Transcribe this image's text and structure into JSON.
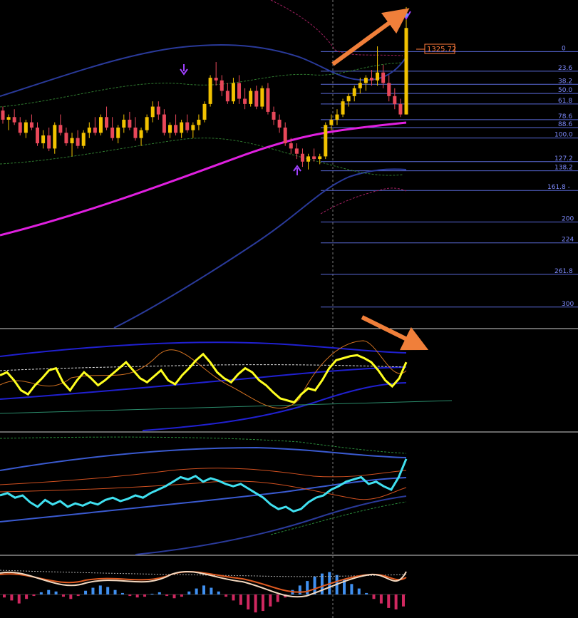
{
  "chart_data": {
    "type": "candlestick-with-indicators",
    "price_tag": "1325.72",
    "colors": {
      "background": "#000000",
      "bull": "#f2c200",
      "bear": "#e8485a",
      "ma": "#e020e0",
      "band_outer": "#2a3a9a",
      "band_inner": "#3a8a3a",
      "fib_line": "#5a6ad8",
      "arrow": "#f07f3a",
      "signal_up": "#a040ff",
      "rsi": "#ffff20",
      "rsi_band": "#2020d0",
      "cyan_line": "#40e0f0",
      "hist_pos": "#4090f0",
      "hist_neg": "#d02860"
    },
    "fib_levels": [
      {
        "label": "0",
        "price": 1310
      },
      {
        "label": "23.6",
        "price": 1295
      },
      {
        "label": "38.2",
        "price": 1285
      },
      {
        "label": "50.0",
        "price": 1278
      },
      {
        "label": "61.8",
        "price": 1270
      },
      {
        "label": "78.6",
        "price": 1258
      },
      {
        "label": "88.6",
        "price": 1252
      },
      {
        "label": "100.0",
        "price": 1244
      },
      {
        "label": "127.2",
        "price": 1226
      },
      {
        "label": "138.2",
        "price": 1219
      },
      {
        "label": "161.8 -",
        "price": 1204
      },
      {
        "label": "200",
        "price": 1180
      },
      {
        "label": "224",
        "price": 1164
      },
      {
        "label": "261.8",
        "price": 1140
      },
      {
        "label": "300",
        "price": 1115
      }
    ],
    "candles": [
      [
        1265,
        1268,
        1255,
        1258
      ],
      [
        1258,
        1262,
        1250,
        1260
      ],
      [
        1260,
        1266,
        1254,
        1256
      ],
      [
        1256,
        1260,
        1246,
        1248
      ],
      [
        1248,
        1258,
        1244,
        1256
      ],
      [
        1256,
        1262,
        1250,
        1252
      ],
      [
        1252,
        1256,
        1238,
        1240
      ],
      [
        1240,
        1250,
        1236,
        1246
      ],
      [
        1246,
        1252,
        1234,
        1236
      ],
      [
        1236,
        1256,
        1232,
        1254
      ],
      [
        1254,
        1262,
        1246,
        1248
      ],
      [
        1248,
        1252,
        1238,
        1240
      ],
      [
        1240,
        1248,
        1230,
        1244
      ],
      [
        1244,
        1250,
        1236,
        1238
      ],
      [
        1238,
        1250,
        1236,
        1248
      ],
      [
        1248,
        1256,
        1244,
        1252
      ],
      [
        1252,
        1260,
        1246,
        1248
      ],
      [
        1248,
        1262,
        1246,
        1260
      ],
      [
        1260,
        1268,
        1250,
        1252
      ],
      [
        1252,
        1260,
        1242,
        1244
      ],
      [
        1244,
        1254,
        1240,
        1252
      ],
      [
        1252,
        1262,
        1248,
        1258
      ],
      [
        1258,
        1264,
        1250,
        1252
      ],
      [
        1252,
        1260,
        1242,
        1244
      ],
      [
        1244,
        1252,
        1238,
        1250
      ],
      [
        1250,
        1262,
        1248,
        1260
      ],
      [
        1260,
        1272,
        1256,
        1268
      ],
      [
        1268,
        1272,
        1258,
        1262
      ],
      [
        1262,
        1266,
        1246,
        1248
      ],
      [
        1248,
        1256,
        1244,
        1254
      ],
      [
        1254,
        1262,
        1246,
        1248
      ],
      [
        1248,
        1258,
        1244,
        1256
      ],
      [
        1256,
        1262,
        1248,
        1250
      ],
      [
        1250,
        1256,
        1244,
        1254
      ],
      [
        1254,
        1262,
        1250,
        1258
      ],
      [
        1258,
        1272,
        1256,
        1270
      ],
      [
        1270,
        1292,
        1268,
        1290
      ],
      [
        1290,
        1302,
        1284,
        1288
      ],
      [
        1288,
        1292,
        1276,
        1280
      ],
      [
        1280,
        1286,
        1270,
        1272
      ],
      [
        1272,
        1290,
        1270,
        1286
      ],
      [
        1286,
        1292,
        1270,
        1274
      ],
      [
        1274,
        1282,
        1266,
        1270
      ],
      [
        1270,
        1282,
        1268,
        1280
      ],
      [
        1280,
        1284,
        1266,
        1268
      ],
      [
        1268,
        1284,
        1266,
        1282
      ],
      [
        1282,
        1286,
        1262,
        1264
      ],
      [
        1264,
        1268,
        1254,
        1258
      ],
      [
        1258,
        1262,
        1248,
        1252
      ],
      [
        1252,
        1256,
        1238,
        1240
      ],
      [
        1240,
        1244,
        1232,
        1236
      ],
      [
        1236,
        1240,
        1228,
        1232
      ],
      [
        1232,
        1236,
        1222,
        1226
      ],
      [
        1226,
        1232,
        1220,
        1230
      ],
      [
        1230,
        1236,
        1226,
        1228
      ],
      [
        1228,
        1232,
        1224,
        1230
      ],
      [
        1230,
        1256,
        1228,
        1254
      ],
      [
        1254,
        1262,
        1250,
        1258
      ],
      [
        1258,
        1266,
        1254,
        1262
      ],
      [
        1262,
        1274,
        1260,
        1272
      ],
      [
        1272,
        1278,
        1268,
        1276
      ],
      [
        1276,
        1284,
        1272,
        1282
      ],
      [
        1282,
        1290,
        1278,
        1286
      ],
      [
        1286,
        1292,
        1280,
        1290
      ],
      [
        1290,
        1296,
        1284,
        1288
      ],
      [
        1288,
        1314,
        1284,
        1294
      ],
      [
        1294,
        1300,
        1282,
        1286
      ],
      [
        1286,
        1292,
        1272,
        1276
      ],
      [
        1276,
        1282,
        1266,
        1270
      ],
      [
        1270,
        1274,
        1260,
        1262
      ],
      [
        1262,
        1344,
        1262,
        1328
      ]
    ],
    "arrows": [
      "price-up",
      "rsi-down"
    ]
  }
}
